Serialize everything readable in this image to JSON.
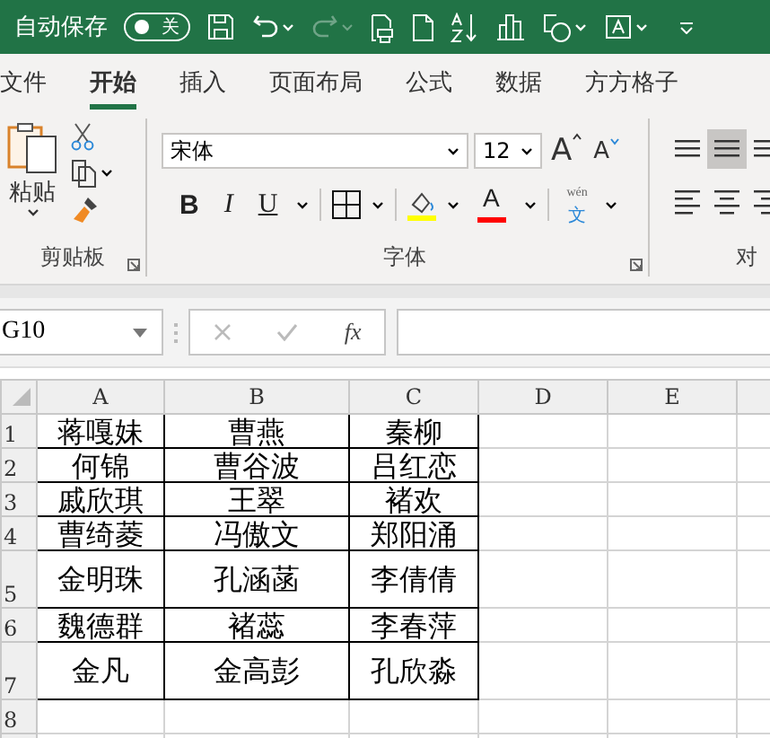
{
  "title_bar": {
    "autosave_label": "自动保存",
    "autosave_toggle": {
      "label": "关",
      "on": false
    },
    "redo_disabled": true
  },
  "tabs": [
    {
      "label": "文件",
      "selected": false
    },
    {
      "label": "开始",
      "selected": true
    },
    {
      "label": "插入",
      "selected": false
    },
    {
      "label": "页面布局",
      "selected": false
    },
    {
      "label": "公式",
      "selected": false
    },
    {
      "label": "数据",
      "selected": false
    },
    {
      "label": "方方格子",
      "selected": false
    }
  ],
  "ribbon": {
    "clipboard": {
      "paste_label": "粘贴",
      "group_label": "剪贴板"
    },
    "font": {
      "font_name": "宋体",
      "font_size": "12",
      "grow_label": "A",
      "shrink_label": "A",
      "bold_label": "B",
      "italic_label": "I",
      "underline_label": "U",
      "font_color_label": "A",
      "phonetic_top": "wén",
      "phonetic_bottom": "文",
      "group_label": "字体"
    },
    "alignment": {
      "group_label": "对",
      "buttons": [
        {
          "kind": "top",
          "selected": false
        },
        {
          "kind": "middle",
          "selected": true
        },
        {
          "kind": "bottom",
          "selected": false
        },
        {
          "kind": "left",
          "selected": false
        },
        {
          "kind": "center",
          "selected": false
        },
        {
          "kind": "right",
          "selected": false
        }
      ]
    }
  },
  "formula_bar": {
    "name_box": "G10",
    "fx_label": "fx"
  },
  "sheet": {
    "columns": [
      "A",
      "B",
      "C",
      "D",
      "E"
    ],
    "rows": [
      {
        "number": "1",
        "tall": false,
        "cells": [
          "蒋嘎妹",
          "曹燕",
          "秦柳"
        ]
      },
      {
        "number": "2",
        "tall": false,
        "cells": [
          "何锦",
          "曹谷波",
          "吕红恋"
        ]
      },
      {
        "number": "3",
        "tall": false,
        "cells": [
          "戚欣琪",
          "王翠",
          "褚欢"
        ]
      },
      {
        "number": "4",
        "tall": false,
        "cells": [
          "曹绮菱",
          "冯傲文",
          "郑阳涌"
        ]
      },
      {
        "number": "5",
        "tall": true,
        "cells": [
          "金明珠",
          "孔涵菡",
          "李倩倩"
        ]
      },
      {
        "number": "6",
        "tall": false,
        "cells": [
          "魏德群",
          "褚蕊",
          "李春萍"
        ]
      },
      {
        "number": "7",
        "tall": true,
        "cells": [
          "金凡",
          "金高彭",
          "孔欣淼"
        ]
      },
      {
        "number": "8",
        "tall": false,
        "cells": []
      }
    ]
  }
}
